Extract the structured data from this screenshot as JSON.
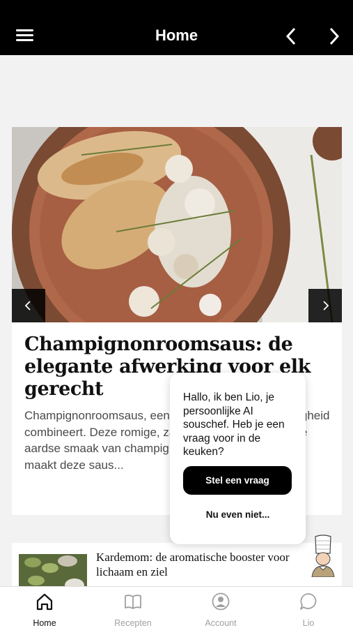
{
  "header": {
    "title": "Home",
    "menu_icon": "hamburger-menu-icon",
    "prev_icon": "chevron-left-icon",
    "next_icon": "chevron-right-icon"
  },
  "feature": {
    "title": "Champignonroomsaus: de elegante afwerking voor elk gerecht",
    "excerpt": "Champignonroomsaus, een saus die rijkheid en hartigheid combineert. Deze romige, zachte saus, verrijkt met de aardse smaak van champignons, is een favoriet. Wat maakt deze saus..."
  },
  "second_card": {
    "title": "Kardemom: de aromatische booster voor lichaam en ziel"
  },
  "popup": {
    "message": "Hallo, ik ben Lio, je persoonlijke AI souschef. Heb je een vraag voor in de keuken?",
    "primary_button": "Stel een vraag",
    "dismiss": "Nu even niet..."
  },
  "tabs": [
    {
      "label": "Home",
      "icon": "home-icon",
      "active": true
    },
    {
      "label": "Recepten",
      "icon": "book-icon",
      "active": false
    },
    {
      "label": "Account",
      "icon": "user-icon",
      "active": false
    },
    {
      "label": "Lio",
      "icon": "chat-icon",
      "active": false
    }
  ],
  "colors": {
    "header_bg": "#000000",
    "page_bg": "#f2f2f2",
    "active_tab": "#111111",
    "inactive_tab": "#a0a0a0"
  }
}
